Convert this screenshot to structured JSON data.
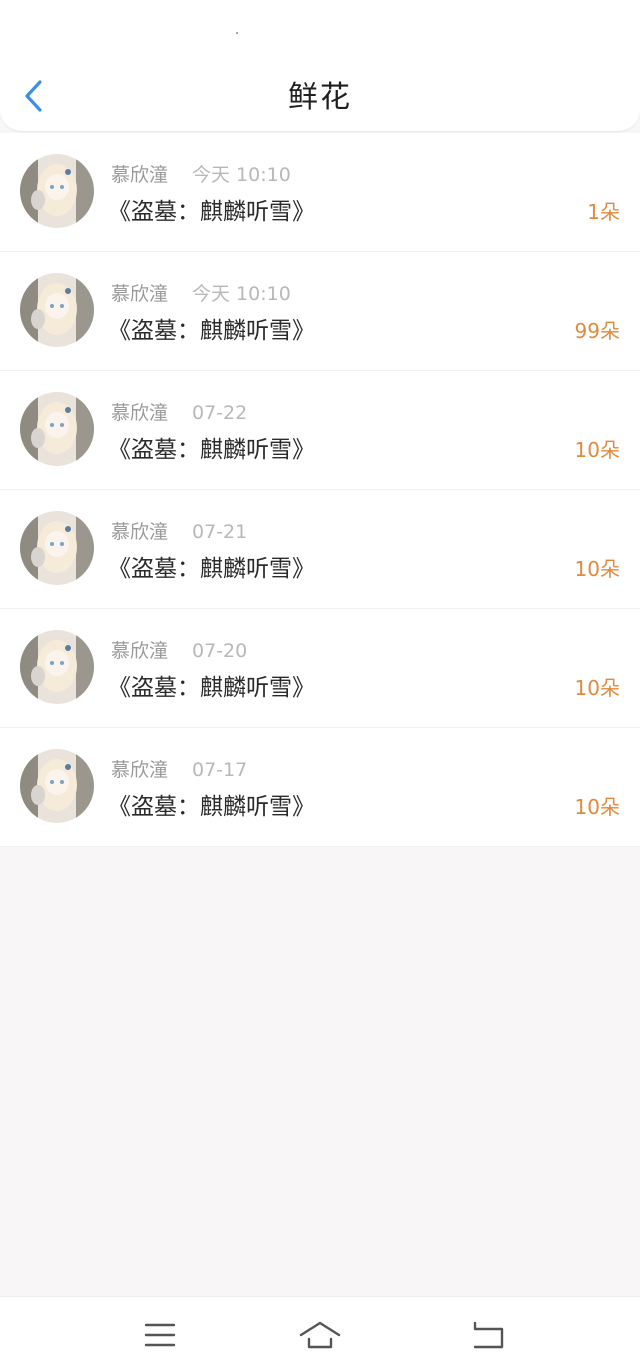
{
  "header": {
    "title": "鲜花",
    "back_icon": "chevron-left-icon",
    "accent_color": "#3a8ee6"
  },
  "records": [
    {
      "name": "慕欣潼",
      "time": "今天 10:10",
      "book": "《盗墓：麒麟听雪》",
      "count": "1朵"
    },
    {
      "name": "慕欣潼",
      "time": "今天 10:10",
      "book": "《盗墓：麒麟听雪》",
      "count": "99朵"
    },
    {
      "name": "慕欣潼",
      "time": "07-22",
      "book": "《盗墓：麒麟听雪》",
      "count": "10朵"
    },
    {
      "name": "慕欣潼",
      "time": "07-21",
      "book": "《盗墓：麒麟听雪》",
      "count": "10朵"
    },
    {
      "name": "慕欣潼",
      "time": "07-20",
      "book": "《盗墓：麒麟听雪》",
      "count": "10朵"
    },
    {
      "name": "慕欣潼",
      "time": "07-17",
      "book": "《盗墓：麒麟听雪》",
      "count": "10朵"
    }
  ],
  "colors": {
    "count": "#e08a3c",
    "name": "#9a9a9a",
    "time": "#b8b8b8",
    "title": "#2b2b2b",
    "background": "#f8f6f6"
  },
  "nav": {
    "menu_icon": "menu-icon",
    "home_icon": "home-icon",
    "back_icon": "back-icon"
  }
}
